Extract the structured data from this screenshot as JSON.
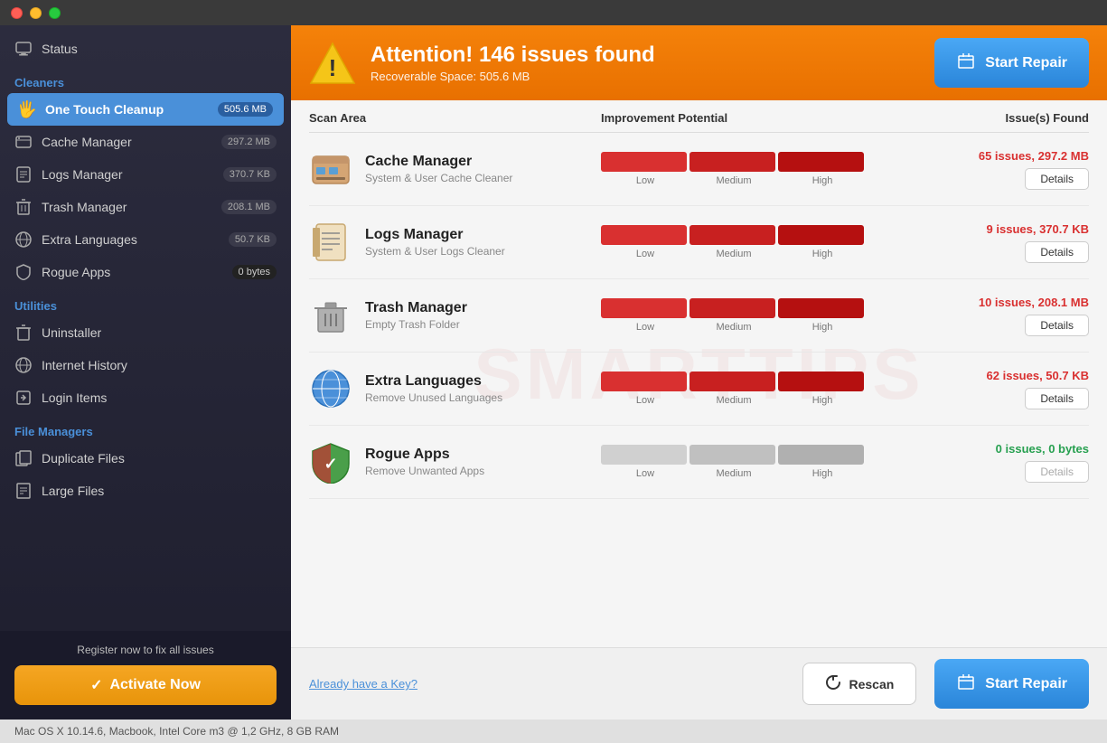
{
  "titlebar": {
    "buttons": [
      "close",
      "minimize",
      "maximize"
    ]
  },
  "sidebar": {
    "sections": [
      {
        "id": "status",
        "items": [
          {
            "id": "status",
            "label": "Status",
            "icon": "monitor",
            "active": false,
            "badge": null
          }
        ]
      },
      {
        "id": "cleaners",
        "label": "Cleaners",
        "items": [
          {
            "id": "one-touch",
            "label": "One Touch Cleanup",
            "icon": "hand",
            "active": true,
            "badge": "505.6 MB"
          },
          {
            "id": "cache",
            "label": "Cache Manager",
            "icon": "cache",
            "active": false,
            "badge": "297.2 MB"
          },
          {
            "id": "logs",
            "label": "Logs Manager",
            "icon": "logs",
            "active": false,
            "badge": "370.7 KB"
          },
          {
            "id": "trash",
            "label": "Trash Manager",
            "icon": "trash",
            "active": false,
            "badge": "208.1 MB"
          },
          {
            "id": "languages",
            "label": "Extra Languages",
            "icon": "globe",
            "active": false,
            "badge": "50.7 KB"
          },
          {
            "id": "rogue",
            "label": "Rogue Apps",
            "icon": "shield",
            "active": false,
            "badge": "0 bytes"
          }
        ]
      },
      {
        "id": "utilities",
        "label": "Utilities",
        "items": [
          {
            "id": "uninstaller",
            "label": "Uninstaller",
            "icon": "trash2",
            "active": false,
            "badge": null
          },
          {
            "id": "internet",
            "label": "Internet History",
            "icon": "globe2",
            "active": false,
            "badge": null
          },
          {
            "id": "login",
            "label": "Login Items",
            "icon": "login",
            "active": false,
            "badge": null
          }
        ]
      },
      {
        "id": "file-managers",
        "label": "File Managers",
        "items": [
          {
            "id": "duplicate",
            "label": "Duplicate Files",
            "icon": "files",
            "active": false,
            "badge": null
          },
          {
            "id": "large",
            "label": "Large Files",
            "icon": "largefile",
            "active": false,
            "badge": null
          }
        ]
      }
    ],
    "bottom": {
      "register_text": "Register now to fix all issues",
      "activate_label": "Activate Now"
    }
  },
  "alert": {
    "title": "Attention! 146 issues found",
    "subtitle": "Recoverable Space: 505.6 MB",
    "start_repair_label": "Start Repair"
  },
  "table": {
    "columns": [
      "Scan Area",
      "Improvement Potential",
      "Issue(s) Found"
    ],
    "rows": [
      {
        "name": "Cache Manager",
        "desc": "System & User Cache Cleaner",
        "icon": "cache",
        "bar_type": "red",
        "issues_text": "65 issues, 297.2 MB",
        "has_details": true
      },
      {
        "name": "Logs Manager",
        "desc": "System & User Logs Cleaner",
        "icon": "logs",
        "bar_type": "red",
        "issues_text": "9 issues, 370.7 KB",
        "has_details": true
      },
      {
        "name": "Trash Manager",
        "desc": "Empty Trash Folder",
        "icon": "trash",
        "bar_type": "red",
        "issues_text": "10 issues, 208.1 MB",
        "has_details": true
      },
      {
        "name": "Extra Languages",
        "desc": "Remove Unused Languages",
        "icon": "globe",
        "bar_type": "red",
        "issues_text": "62 issues, 50.7 KB",
        "has_details": true
      },
      {
        "name": "Rogue Apps",
        "desc": "Remove Unwanted Apps",
        "icon": "shield",
        "bar_type": "gray",
        "issues_text": "0 issues, 0 bytes",
        "has_details": false
      }
    ]
  },
  "bottom": {
    "already_key_label": "Already have a Key?",
    "rescan_label": "Rescan",
    "start_repair_label": "Start Repair"
  },
  "status_bar": {
    "text": "Mac OS X 10.14.6, Macbook, Intel Core m3 @ 1,2 GHz, 8 GB RAM"
  },
  "watermark": "SMARTTIPS"
}
